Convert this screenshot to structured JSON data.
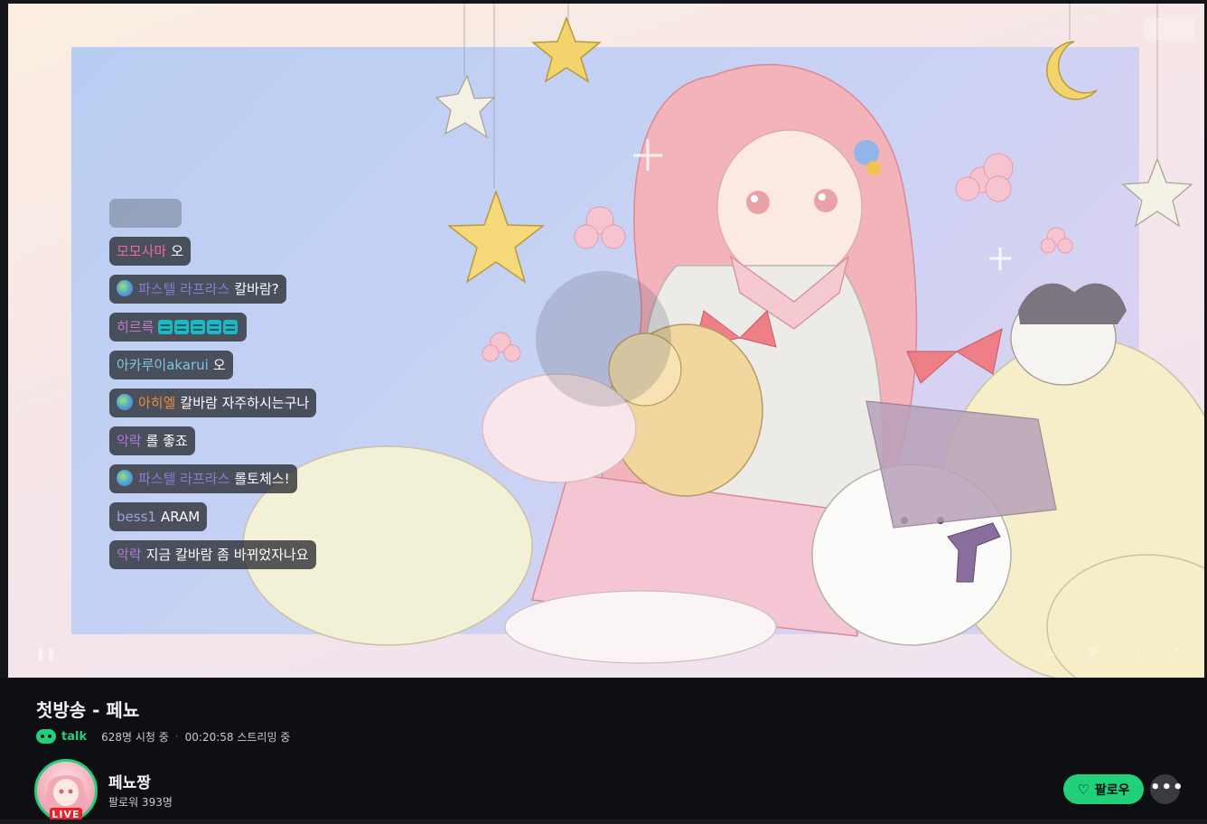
{
  "stream": {
    "title": "첫방송 - 페뇨",
    "talk_label": "talk",
    "viewers": "628명 시청 중",
    "uptime": "00:20:58 스트리밍 중"
  },
  "channel": {
    "name": "페뇨짱",
    "followers": "팔로워 393명",
    "live_badge": "LIVE"
  },
  "actions": {
    "follow_label": "팔로우",
    "more_label": "•••"
  },
  "chat": [
    {
      "nick": "",
      "text": "",
      "faded": true
    },
    {
      "nick": "모모사마",
      "text": "오",
      "nick_color": "#e86aa8"
    },
    {
      "nick": "파스텔 라프라스",
      "text": "칼바람?",
      "nick_color": "#8a7bd6",
      "badge": true
    },
    {
      "nick": "히르륵",
      "text": "",
      "nick_color": "#c07ad0",
      "emotes": 5
    },
    {
      "nick": "아카루이akarui",
      "text": "오",
      "nick_color": "#7ec3e6"
    },
    {
      "nick": "아히엘",
      "text": "칼바람 자주하시는구나",
      "nick_color": "#f08a3c",
      "badge": true
    },
    {
      "nick": "악락",
      "text": "롤 좋죠",
      "nick_color": "#b07ad6"
    },
    {
      "nick": "파스텔 라프라스",
      "text": "롤토체스!",
      "nick_color": "#8a7bd6",
      "badge": true
    },
    {
      "nick": "bess1",
      "text": "ARAM",
      "nick_color": "#9aa4e0"
    },
    {
      "nick": "악락",
      "text": "지금 칼바람 좀 바뀌었자나요",
      "nick_color": "#b07ad6"
    }
  ],
  "icons": {
    "talk": "chat-bot-icon",
    "follow": "heart-icon",
    "more": "more-dots-icon"
  },
  "colors": {
    "accent": "#21d07a",
    "live": "#e8202c",
    "background": "#0e0f12"
  }
}
